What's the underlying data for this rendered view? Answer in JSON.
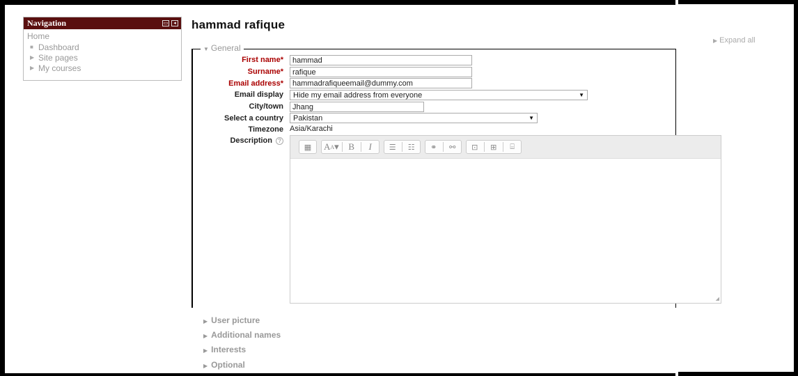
{
  "navigation": {
    "title": "Navigation",
    "home": "Home",
    "items": [
      {
        "label": "Dashboard",
        "bullet": "■"
      },
      {
        "label": "Site pages",
        "bullet": "▶"
      },
      {
        "label": "My courses",
        "bullet": "▶"
      }
    ]
  },
  "page": {
    "title": "hammad rafique",
    "expand_all": "Expand all"
  },
  "general": {
    "legend": "General",
    "fields": {
      "first_name": {
        "label": "First name",
        "value": "hammad"
      },
      "surname": {
        "label": "Surname",
        "value": "rafique"
      },
      "email": {
        "label": "Email address",
        "value": "hammadrafiqueemail@dummy.com"
      },
      "email_display": {
        "label": "Email display",
        "value": "Hide my email address from everyone"
      },
      "city": {
        "label": "City/town",
        "value": "Jhang"
      },
      "country": {
        "label": "Select a country",
        "value": "Pakistan"
      },
      "timezone": {
        "label": "Timezone",
        "value": "Asia/Karachi"
      },
      "description": {
        "label": "Description"
      }
    }
  },
  "sections": [
    {
      "label": "User picture"
    },
    {
      "label": "Additional names"
    },
    {
      "label": "Interests"
    },
    {
      "label": "Optional"
    }
  ]
}
